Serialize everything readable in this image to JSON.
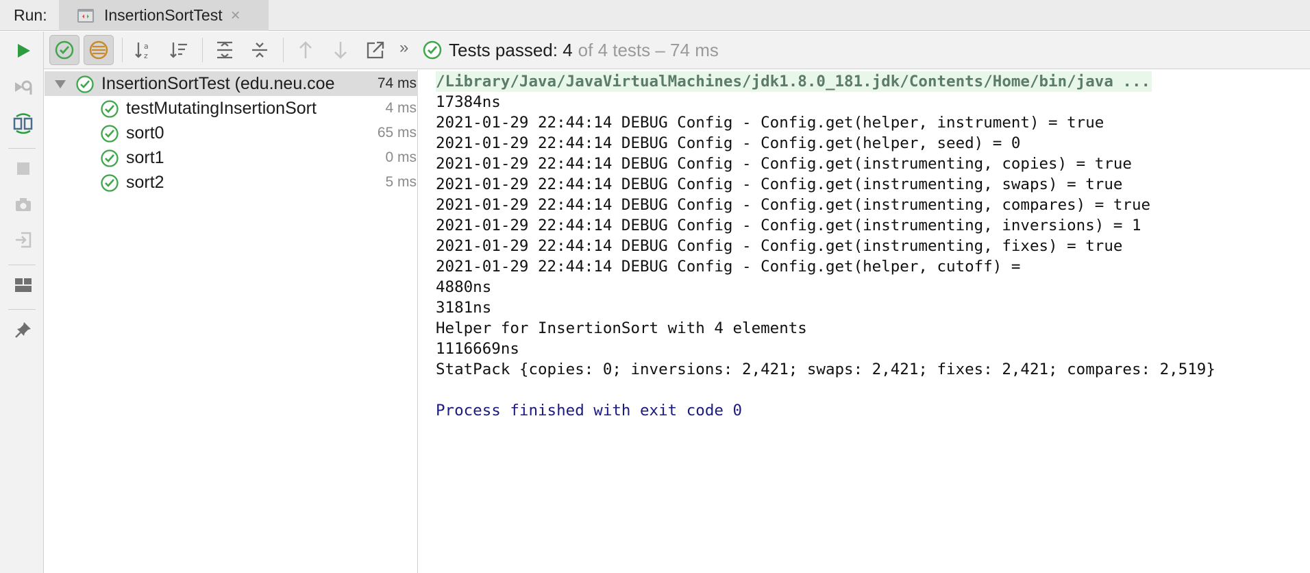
{
  "run_panel": {
    "label": "Run:",
    "tab": {
      "title": "InsertionSortTest",
      "close": "×"
    }
  },
  "toolbar": {
    "more": "»",
    "status": {
      "main": "Tests passed: 4",
      "rest": "of 4 tests – 74 ms"
    },
    "buttons": [
      "show-passed-icon",
      "show-ignored-icon",
      "sort-alphabetically-icon",
      "sort-by-duration-icon",
      "expand-all-icon",
      "collapse-all-icon",
      "previous-failed-icon",
      "next-failed-icon",
      "export-icon"
    ]
  },
  "left_tools": [
    "rerun-icon",
    "rerun-failed-icon",
    "toggle-auto-test-icon",
    "stop-icon",
    "camera-icon",
    "exit-icon",
    "layout-icon",
    "pin-icon"
  ],
  "tree": {
    "root": {
      "name": "InsertionSortTest (edu.neu.coe",
      "time": "74 ms"
    },
    "children": [
      {
        "name": "testMutatingInsertionSort",
        "time": "4 ms"
      },
      {
        "name": "sort0",
        "time": "65 ms"
      },
      {
        "name": "sort1",
        "time": "0 ms"
      },
      {
        "name": "sort2",
        "time": "5 ms"
      }
    ]
  },
  "console": {
    "command": "/Library/Java/JavaVirtualMachines/jdk1.8.0_181.jdk/Contents/Home/bin/java ...",
    "lines": [
      "17384ns",
      "2021-01-29 22:44:14 DEBUG Config - Config.get(helper, instrument) = true",
      "2021-01-29 22:44:14 DEBUG Config - Config.get(helper, seed) = 0",
      "2021-01-29 22:44:14 DEBUG Config - Config.get(instrumenting, copies) = true",
      "2021-01-29 22:44:14 DEBUG Config - Config.get(instrumenting, swaps) = true",
      "2021-01-29 22:44:14 DEBUG Config - Config.get(instrumenting, compares) = true",
      "2021-01-29 22:44:14 DEBUG Config - Config.get(instrumenting, inversions) = 1",
      "2021-01-29 22:44:14 DEBUG Config - Config.get(instrumenting, fixes) = true",
      "2021-01-29 22:44:14 DEBUG Config - Config.get(helper, cutoff) =",
      "4880ns",
      "3181ns",
      "Helper for InsertionSort with 4 elements",
      "1116669ns",
      "StatPack {copies: 0; inversions: 2,421; swaps: 2,421; fixes: 2,421; compares: 2,519}"
    ],
    "exit_message": "Process finished with exit code 0"
  },
  "colors": {
    "pass_green": "#3fa64b",
    "run_green": "#2e9b3e",
    "exit_text": "#1a1a80",
    "command_bg": "#e9f6ea"
  }
}
